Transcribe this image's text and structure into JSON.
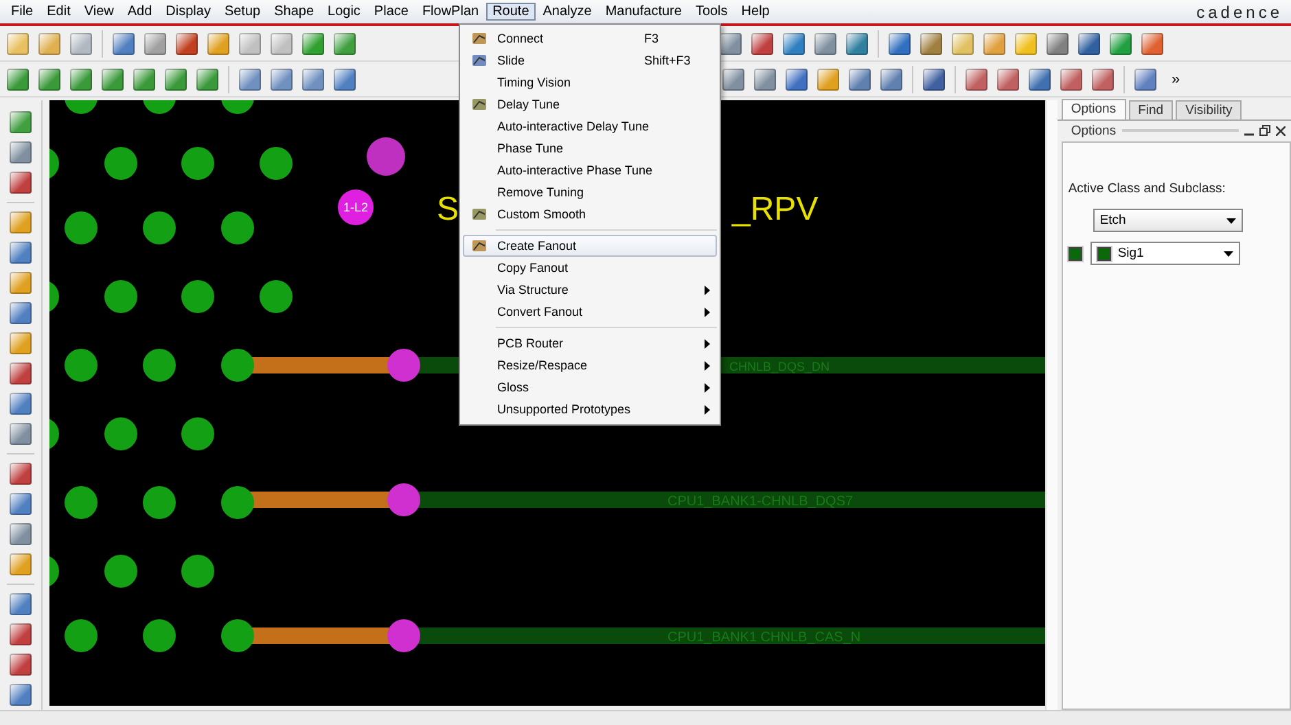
{
  "menubar": {
    "items": [
      {
        "label": "File",
        "selected": false
      },
      {
        "label": "Edit",
        "selected": false
      },
      {
        "label": "View",
        "selected": false
      },
      {
        "label": "Add",
        "selected": false
      },
      {
        "label": "Display",
        "selected": false
      },
      {
        "label": "Setup",
        "selected": false
      },
      {
        "label": "Shape",
        "selected": false
      },
      {
        "label": "Logic",
        "selected": false
      },
      {
        "label": "Place",
        "selected": false
      },
      {
        "label": "FlowPlan",
        "selected": false
      },
      {
        "label": "Route",
        "selected": true
      },
      {
        "label": "Analyze",
        "selected": false
      },
      {
        "label": "Manufacture",
        "selected": false
      },
      {
        "label": "Tools",
        "selected": false
      },
      {
        "label": "Help",
        "selected": false
      }
    ],
    "logo": "cadence"
  },
  "toolbar": {
    "overflow": "»"
  },
  "route_menu": [
    {
      "kind": "item",
      "label": "Connect",
      "shortcut": "F3",
      "icon": true,
      "submenu": false,
      "selected": false
    },
    {
      "kind": "item",
      "label": "Slide",
      "shortcut": "Shift+F3",
      "icon": true,
      "submenu": false,
      "selected": false
    },
    {
      "kind": "item",
      "label": "Timing Vision",
      "icon": false,
      "submenu": false,
      "selected": false
    },
    {
      "kind": "item",
      "label": "Delay Tune",
      "icon": true,
      "submenu": false,
      "selected": false
    },
    {
      "kind": "item",
      "label": "Auto-interactive Delay Tune",
      "icon": false,
      "submenu": false,
      "selected": false
    },
    {
      "kind": "item",
      "label": "Phase Tune",
      "icon": false,
      "submenu": false,
      "selected": false
    },
    {
      "kind": "item",
      "label": "Auto-interactive Phase Tune",
      "icon": false,
      "submenu": false,
      "selected": false
    },
    {
      "kind": "item",
      "label": "Remove Tuning",
      "icon": false,
      "submenu": false,
      "selected": false
    },
    {
      "kind": "item",
      "label": "Custom Smooth",
      "icon": true,
      "submenu": false,
      "selected": false
    },
    {
      "kind": "separator"
    },
    {
      "kind": "item",
      "label": "Create Fanout",
      "icon": true,
      "submenu": false,
      "selected": true
    },
    {
      "kind": "item",
      "label": "Copy Fanout",
      "icon": false,
      "submenu": false,
      "selected": false
    },
    {
      "kind": "item",
      "label": "Via Structure",
      "icon": false,
      "submenu": true,
      "selected": false
    },
    {
      "kind": "item",
      "label": "Convert Fanout",
      "icon": false,
      "submenu": true,
      "selected": false
    },
    {
      "kind": "separator"
    },
    {
      "kind": "item",
      "label": "PCB Router",
      "icon": false,
      "submenu": true,
      "selected": false
    },
    {
      "kind": "item",
      "label": "Resize/Respace",
      "icon": false,
      "submenu": true,
      "selected": false
    },
    {
      "kind": "item",
      "label": "Gloss",
      "icon": false,
      "submenu": true,
      "selected": false
    },
    {
      "kind": "item",
      "label": "Unsupported Prototypes",
      "icon": false,
      "submenu": true,
      "selected": false
    }
  ],
  "canvas": {
    "pad_label": "1-L2",
    "title_fragments": [
      "S",
      "_RPV"
    ],
    "nets": [
      "CHNLB_DQS_DN",
      "CPU1_BANK1-CHNLB_DQS7",
      "CPU1_BANK1 CHNLB_CAS_N"
    ]
  },
  "panel": {
    "tabs": [
      {
        "label": "Options",
        "selected": true
      },
      {
        "label": "Find",
        "selected": false
      },
      {
        "label": "Visibility",
        "selected": false
      }
    ],
    "title": "Options",
    "heading": "Active Class and Subclass:",
    "class_value": "Etch",
    "subclass_value": "Sig1"
  }
}
